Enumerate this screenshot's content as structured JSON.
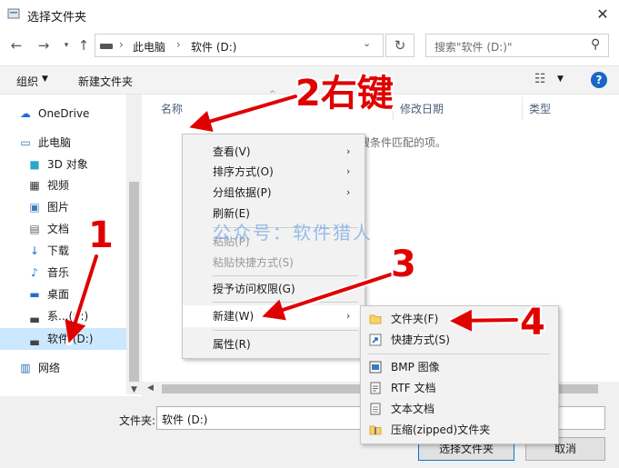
{
  "window": {
    "title": "选择文件夹",
    "close_glyph": "✕"
  },
  "address": {
    "sep": "›",
    "crumb1": "此电脑",
    "crumb2": "软件 (D:)",
    "search_placeholder": "搜索\"软件 (D:)\""
  },
  "toolbar": {
    "organize": "组织",
    "new_folder": "新建文件夹"
  },
  "sidebar": {
    "items": [
      {
        "label": "OneDrive",
        "icon": "cloud-icon"
      },
      {
        "label": "此电脑",
        "icon": "computer-icon"
      },
      {
        "label": "3D 对象",
        "icon": "cube-icon"
      },
      {
        "label": "视频",
        "icon": "video-icon"
      },
      {
        "label": "图片",
        "icon": "picture-icon"
      },
      {
        "label": "文档",
        "icon": "document-icon"
      },
      {
        "label": "下载",
        "icon": "download-icon"
      },
      {
        "label": "音乐",
        "icon": "music-icon"
      },
      {
        "label": "桌面",
        "icon": "desktop-icon"
      },
      {
        "label": "系...(C:)",
        "icon": "drive-icon"
      },
      {
        "label": "软件 (D:)",
        "icon": "drive-icon"
      },
      {
        "label": "网络",
        "icon": "network-icon"
      }
    ],
    "selected": "软件 (D:)"
  },
  "columns": {
    "name": "名称",
    "date": "修改日期",
    "type": "类型"
  },
  "empty_message": "搜条件匹配的项。",
  "context_menu": {
    "items": [
      {
        "label": "查看(V)",
        "submenu": true,
        "enabled": true
      },
      {
        "label": "排序方式(O)",
        "submenu": true,
        "enabled": true
      },
      {
        "label": "分组依据(P)",
        "submenu": true,
        "enabled": true
      },
      {
        "label": "刷新(E)",
        "submenu": false,
        "enabled": true
      },
      {
        "label": "粘贴(P)",
        "submenu": false,
        "enabled": false
      },
      {
        "label": "粘贴快捷方式(S)",
        "submenu": false,
        "enabled": false
      },
      {
        "label": "授予访问权限(G)",
        "submenu": true,
        "enabled": true
      },
      {
        "label": "新建(W)",
        "submenu": true,
        "enabled": true,
        "highlighted": true
      },
      {
        "label": "属性(R)",
        "submenu": false,
        "enabled": true
      }
    ]
  },
  "submenu_new": {
    "items": [
      {
        "label": "文件夹(F)",
        "icon": "folder-icon"
      },
      {
        "label": "快捷方式(S)",
        "icon": "shortcut-icon"
      },
      {
        "label": "BMP 图像",
        "icon": "bmp-icon"
      },
      {
        "label": "RTF 文档",
        "icon": "rtf-icon"
      },
      {
        "label": "文本文档",
        "icon": "text-doc-icon"
      },
      {
        "label": "压缩(zipped)文件夹",
        "icon": "zip-icon"
      }
    ]
  },
  "bottom": {
    "folder_label": "文件夹:",
    "folder_value": "软件 (D:)",
    "select_button": "选择文件夹",
    "cancel_button": "取消"
  },
  "annotations": {
    "step1": "1",
    "step2": "2右键",
    "step3": "3",
    "step4": "4",
    "color": "#e00000"
  },
  "watermark": "公众号：软件猎人"
}
